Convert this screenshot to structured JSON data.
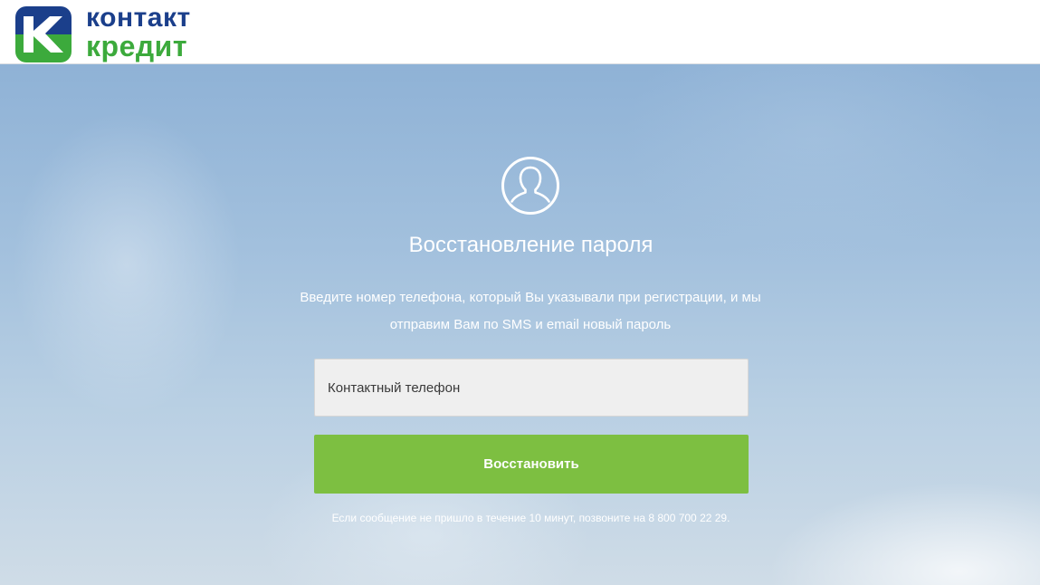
{
  "header": {
    "logo": {
      "line1": "контакт",
      "line2": "кредит",
      "line1_color": "#1b3f8b",
      "line2_color": "#3caa3c",
      "mark_icon": "k-logo-icon"
    }
  },
  "main": {
    "icon": "user-avatar-icon",
    "title": "Восстановление пароля",
    "description": "Введите номер телефона, который Вы указывали при регистрации, и мы отправим Вам по SMS и email новый пароль",
    "phone_input": {
      "value": "",
      "placeholder": "Контактный телефон"
    },
    "submit_label": "Восстановить",
    "note": "Если сообщение не пришло в течение 10 минут, позвоните на 8 800 700 22 29."
  },
  "colors": {
    "button": "#7dbf41",
    "text_on_bg": "#ffffff"
  }
}
